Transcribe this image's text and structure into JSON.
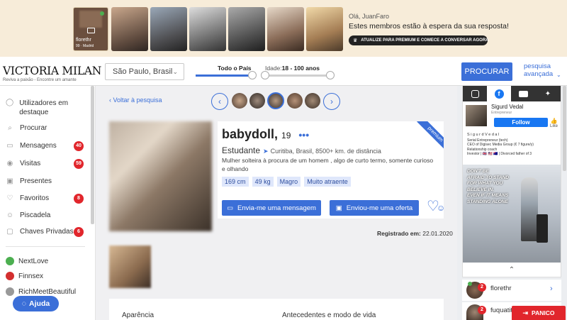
{
  "banner": {
    "featured_name": "florethr",
    "featured_badge": "Vip",
    "featured_sub": "99 · Madrid",
    "greeting": "Olá, JuanFaro",
    "headline": "Estes membros estão à espera da sua resposta!",
    "cta": "ATUALIZE PARA PREMIUM E COMECE A CONVERSAR AGORA"
  },
  "logo": {
    "name": "VICTORIA MILAN",
    "tagline": "Reviva a paixão - Encontre um amante"
  },
  "search": {
    "location": "São Paulo, Brasil",
    "country_label": "Todo o País",
    "age_label": "Idade:",
    "age_range": "18 - 100 anos",
    "button": "PROCURAR",
    "advanced": "pesquisa avançada"
  },
  "sidebar": {
    "items": [
      {
        "label": "Utilizadores em destaque",
        "icon": "user-outline-icon",
        "badge": ""
      },
      {
        "label": "Procurar",
        "icon": "search-icon",
        "badge": ""
      },
      {
        "label": "Mensagens",
        "icon": "chat-icon",
        "badge": "40"
      },
      {
        "label": "Visitas",
        "icon": "eye-icon",
        "badge": "59"
      },
      {
        "label": "Presentes",
        "icon": "gift-icon",
        "badge": ""
      },
      {
        "label": "Favoritos",
        "icon": "heart-icon",
        "badge": "8"
      },
      {
        "label": "Piscadela",
        "icon": "wink-icon",
        "badge": ""
      },
      {
        "label": "Chaves Privadas",
        "icon": "lock-icon",
        "badge": "6"
      }
    ],
    "partners": [
      "NextLove",
      "Finnsex",
      "RichMeetBeautiful"
    ],
    "help": "Ajuda"
  },
  "profile": {
    "back": "Voltar à pesquisa",
    "name": "babydoll,",
    "age": "19",
    "ribbon": "premium",
    "status": "Estudante",
    "location": "Curitiba, Brasil, 8500+ km. de distância",
    "about": "Mulher solteira à procura de um homem , algo de curto termo, somente curioso e olhando",
    "tags": [
      "169 cm",
      "49 kg",
      "Magro",
      "Muito atraente"
    ],
    "msg_button": "Envia-me uma mensagem",
    "offer_button": "Enviou-me uma oferta",
    "registered_label": "Registrado em:",
    "registered_date": "22.01.2020",
    "section_left": "Aparência",
    "section_right": "Antecedentes e modo de vida"
  },
  "ad": {
    "name": "Sigurd Vedal",
    "role": "Entrepreneur",
    "follow": "Follow",
    "like": "Like",
    "bio_name": "S i g u r d V e d a l",
    "bio_lines": [
      "Serial Entrepreneur (tech)",
      "CEO of Digisec Media Group (€ 7 figure/y)",
      "Relationship coach",
      "Investor | 🇬🇧 🇺🇸 🇦🇺 | Divorced father of 3"
    ],
    "poster_text": [
      "DON'T BE",
      "AFRAID TO STAND",
      "FOR WHAT YOU",
      "BELIEVE IN.",
      "EVEN IF IT MEANS",
      "STANDING ALONE"
    ]
  },
  "chats": [
    {
      "name": "florethr",
      "count": "2"
    },
    {
      "name": "fuquatit",
      "count": "2"
    }
  ],
  "panic": "PANICO",
  "colors": {
    "accent": "#3b6fd8",
    "badge": "#e1262c",
    "panic": "#e1262c"
  }
}
